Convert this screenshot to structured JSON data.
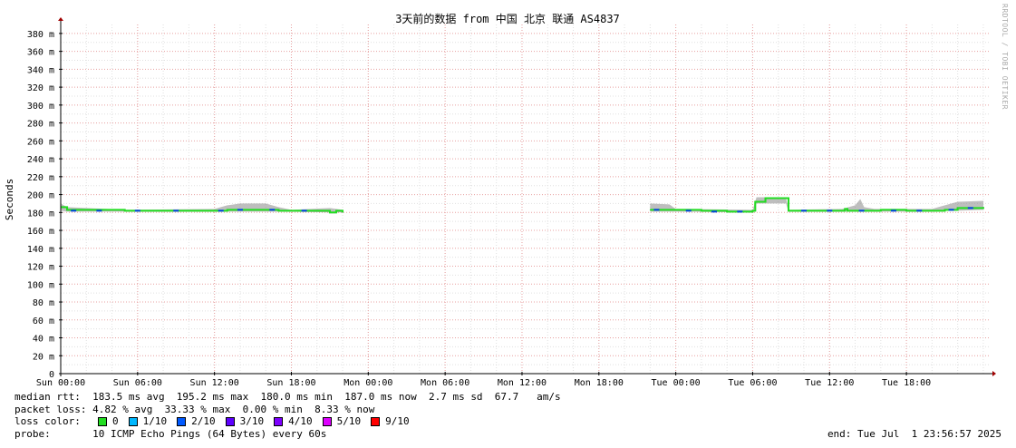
{
  "chart_data": {
    "type": "line",
    "title": "3天前的数据 from 中国 北京 联通 AS4837",
    "ylabel": "Seconds",
    "ylim": [
      0,
      390
    ],
    "grid": true,
    "yticks": [
      0,
      20,
      40,
      60,
      80,
      100,
      120,
      140,
      160,
      180,
      200,
      220,
      240,
      260,
      280,
      300,
      320,
      340,
      360,
      380
    ],
    "ytick_labels": [
      "0",
      "20 m",
      "40 m",
      "60 m",
      "80 m",
      "100 m",
      "120 m",
      "140 m",
      "160 m",
      "180 m",
      "200 m",
      "220 m",
      "240 m",
      "260 m",
      "280 m",
      "300 m",
      "320 m",
      "340 m",
      "360 m",
      "380 m"
    ],
    "x_range_hours": [
      0,
      72.5
    ],
    "xticks_hours": [
      0,
      6,
      12,
      18,
      24,
      30,
      36,
      42,
      48,
      54,
      60,
      66
    ],
    "xtick_labels": [
      "Sun 00:00",
      "Sun 06:00",
      "Sun 12:00",
      "Sun 18:00",
      "Mon 00:00",
      "Mon 06:00",
      "Mon 12:00",
      "Mon 18:00",
      "Tue 00:00",
      "Tue 06:00",
      "Tue 12:00",
      "Tue 18:00"
    ],
    "series": [
      {
        "name": "median rtt",
        "segments": [
          [
            [
              0,
              186
            ],
            [
              0.5,
              183
            ],
            [
              5,
              182
            ],
            [
              10,
              182
            ],
            [
              12,
              182
            ],
            [
              13,
              183
            ],
            [
              14,
              183
            ],
            [
              15.5,
              183
            ],
            [
              17,
              182
            ],
            [
              18,
              182
            ],
            [
              19,
              182
            ],
            [
              20,
              182
            ],
            [
              21,
              180
            ],
            [
              21.5,
              182
            ],
            [
              22,
              180
            ]
          ],
          [
            [
              46,
              183
            ],
            [
              48,
              183
            ],
            [
              50,
              182
            ],
            [
              52,
              181
            ],
            [
              54,
              182
            ],
            [
              54.2,
              192
            ],
            [
              55,
              196
            ],
            [
              56.6,
              196
            ],
            [
              56.8,
              182
            ],
            [
              60,
              182
            ],
            [
              61,
              182
            ],
            [
              61.2,
              184
            ],
            [
              61.4,
              182
            ],
            [
              63,
              182
            ],
            [
              64,
              183
            ],
            [
              66,
              182
            ],
            [
              68,
              182
            ],
            [
              69,
              183
            ],
            [
              70,
              185
            ],
            [
              72,
              186
            ]
          ]
        ]
      }
    ],
    "band_series": {
      "name": "rtt spread",
      "segments": [
        [
          [
            0,
            182,
            190
          ],
          [
            0.5,
            181,
            186
          ],
          [
            5,
            181,
            183
          ],
          [
            12,
            181,
            184
          ],
          [
            13,
            181,
            188
          ],
          [
            14,
            181,
            190
          ],
          [
            16,
            181,
            190
          ],
          [
            17,
            181,
            186
          ],
          [
            18,
            181,
            183
          ],
          [
            21,
            180,
            185
          ],
          [
            22,
            180,
            183
          ]
        ],
        [
          [
            46,
            181,
            190
          ],
          [
            47.5,
            181,
            189
          ],
          [
            48,
            181,
            184
          ],
          [
            54,
            180,
            183
          ],
          [
            54.3,
            190,
            197
          ],
          [
            56.6,
            190,
            197
          ],
          [
            56.8,
            181,
            183
          ],
          [
            61,
            181,
            184
          ],
          [
            62,
            181,
            188
          ],
          [
            62.4,
            181,
            195
          ],
          [
            62.7,
            181,
            186
          ],
          [
            63.5,
            181,
            184
          ],
          [
            68,
            181,
            184
          ],
          [
            69,
            182,
            188
          ],
          [
            70,
            182,
            192
          ],
          [
            72,
            183,
            193
          ]
        ]
      ]
    },
    "loss_points_blue": [
      [
        1,
        182
      ],
      [
        3,
        182
      ],
      [
        6,
        182
      ],
      [
        9,
        182
      ],
      [
        12.5,
        182
      ],
      [
        14,
        183
      ],
      [
        16.5,
        183
      ],
      [
        19,
        182
      ],
      [
        46.5,
        183
      ],
      [
        49,
        182
      ],
      [
        51,
        181
      ],
      [
        53,
        181
      ],
      [
        58,
        182
      ],
      [
        60,
        182
      ],
      [
        62.5,
        182
      ],
      [
        65,
        182
      ],
      [
        67,
        182
      ],
      [
        69.5,
        183
      ],
      [
        71,
        185
      ]
    ],
    "loss_point_color": "#0044dd",
    "line_color": "#22dd22",
    "band_color": "#888888",
    "median_edge_color": "#003300"
  },
  "stats": {
    "median_rtt": "median rtt:  183.5 ms avg  195.2 ms max  180.0 ms min  187.0 ms now  2.7 ms sd  67.7   am/s",
    "packet_loss": "packet loss: 4.82 % avg  33.33 % max  0.00 % min  8.33 % now",
    "probe": "probe:       10 ICMP Echo Pings (64 Bytes) every 60s",
    "end": "end: Tue Jul  1 23:56:57 2025"
  },
  "legend": {
    "label": "loss color:",
    "items": [
      {
        "label": "0",
        "color": "#22dd22"
      },
      {
        "label": "1/10",
        "color": "#00b8ff"
      },
      {
        "label": "2/10",
        "color": "#0059ff"
      },
      {
        "label": "3/10",
        "color": "#5e00ff"
      },
      {
        "label": "4/10",
        "color": "#7e00ff"
      },
      {
        "label": "5/10",
        "color": "#dd00ff"
      },
      {
        "label": "9/10",
        "color": "#ff0000"
      }
    ]
  },
  "watermark": "RRDTOOL / TOBI OETIKER"
}
